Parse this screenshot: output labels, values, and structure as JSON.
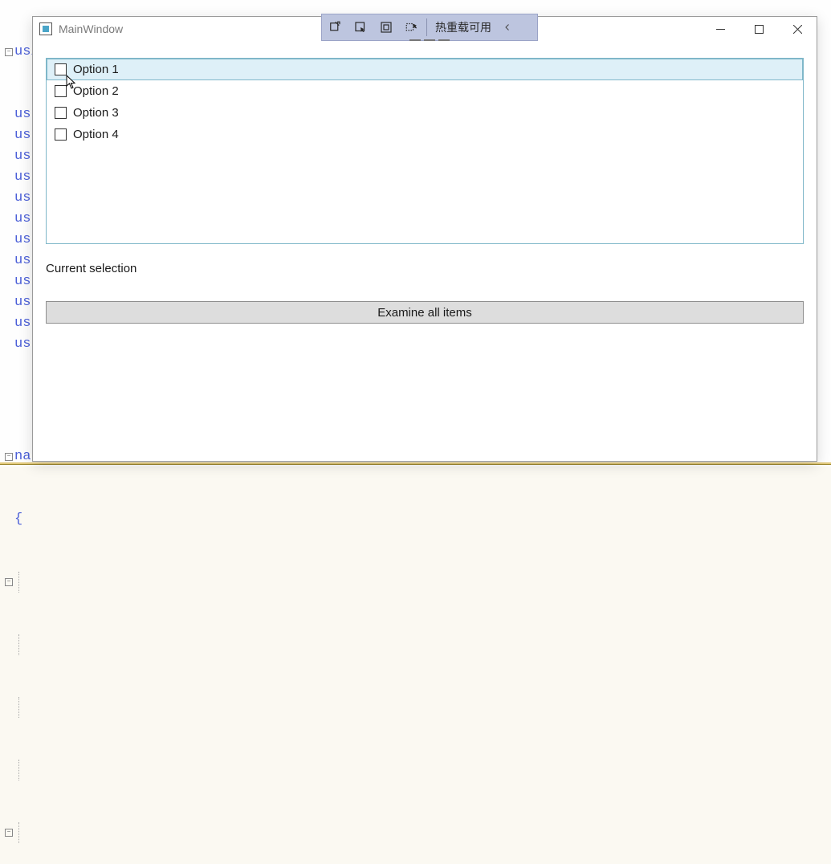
{
  "code_bg": {
    "first_line": "using System;",
    "using_lines_count": 12,
    "using_prefix": "us",
    "namespace_prefix": "na",
    "brace": "{"
  },
  "debug_toolbar": {
    "hot_reload_label": "热重载可用"
  },
  "window": {
    "title": "MainWindow"
  },
  "listbox": {
    "items": [
      {
        "label": "Option 1",
        "checked": false,
        "selected": true
      },
      {
        "label": "Option 2",
        "checked": false,
        "selected": false
      },
      {
        "label": "Option 3",
        "checked": false,
        "selected": false
      },
      {
        "label": "Option 4",
        "checked": false,
        "selected": false
      }
    ]
  },
  "selection_label": "Current selection",
  "examine_button_label": "Examine all items"
}
